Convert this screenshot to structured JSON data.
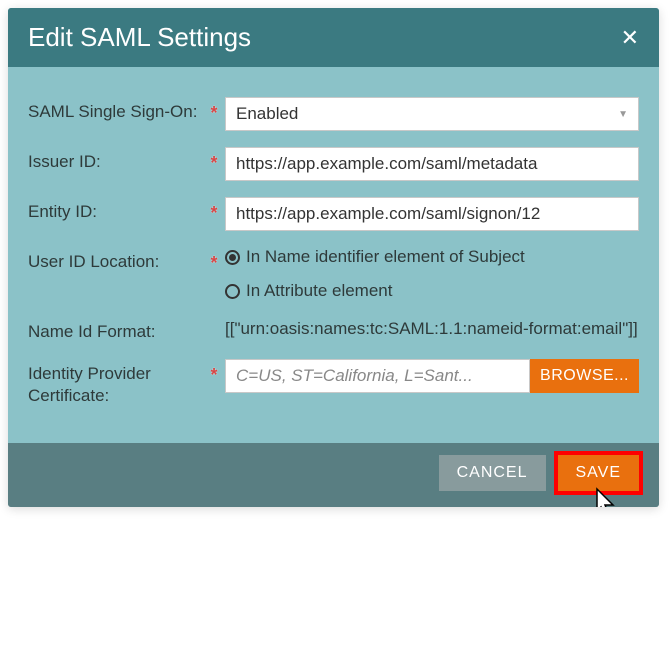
{
  "dialog": {
    "title": "Edit SAML Settings"
  },
  "fields": {
    "sso": {
      "label": "SAML Single Sign-On:",
      "value": "Enabled"
    },
    "issuer": {
      "label": "Issuer ID:",
      "value": "https://app.example.com/saml/metadata"
    },
    "entity": {
      "label": "Entity ID:",
      "value": "https://app.example.com/saml/signon/12"
    },
    "uid": {
      "label": "User ID Location:",
      "option1": "In Name identifier element of Subject",
      "option2": "In Attribute element"
    },
    "nameformat": {
      "label": "Name Id Format:",
      "value": "[[\"urn:oasis:names:tc:SAML:1.1:nameid-format:email\"]]"
    },
    "cert": {
      "label": "Identity Provider Certificate:",
      "value": "C=US, ST=California, L=Sant...",
      "browse": "BROWSE..."
    }
  },
  "footer": {
    "cancel": "CANCEL",
    "save": "SAVE"
  },
  "required_mark": "*"
}
